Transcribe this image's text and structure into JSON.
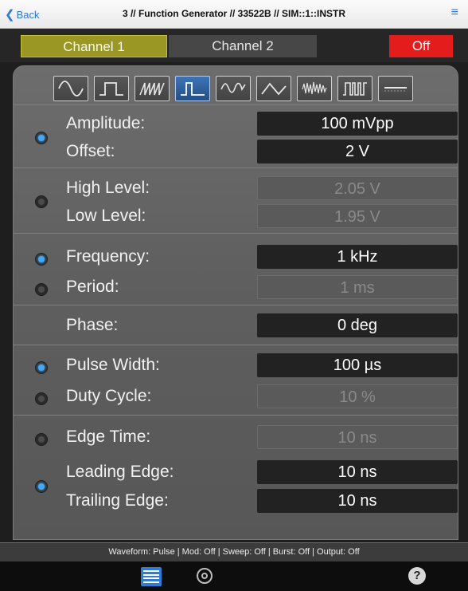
{
  "nav": {
    "back_label": "Back",
    "title": "3 // Function Generator // 33522B // SIM::1::INSTR"
  },
  "channels": {
    "ch1": "Channel 1",
    "ch2": "Channel 2",
    "output": "Off"
  },
  "waveforms": [
    {
      "icon": "sine-wave-icon",
      "active": false
    },
    {
      "icon": "square-wave-icon",
      "active": false
    },
    {
      "icon": "ramp-wave-icon",
      "active": false
    },
    {
      "icon": "pulse-wave-icon",
      "active": true
    },
    {
      "icon": "arbitrary-wave-icon",
      "active": false
    },
    {
      "icon": "triangle-wave-icon",
      "active": false
    },
    {
      "icon": "noise-wave-icon",
      "active": false
    },
    {
      "icon": "prbs-wave-icon",
      "active": false
    },
    {
      "icon": "dc-wave-icon",
      "active": false
    }
  ],
  "params": {
    "amplitude": {
      "label": "Amplitude:",
      "value": "100 mVpp"
    },
    "offset": {
      "label": "Offset:",
      "value": "2 V"
    },
    "high_level": {
      "label": "High Level:",
      "value": "2.05 V"
    },
    "low_level": {
      "label": "Low Level:",
      "value": "1.95 V"
    },
    "frequency": {
      "label": "Frequency:",
      "value": "1 kHz"
    },
    "period": {
      "label": "Period:",
      "value": "1 ms"
    },
    "phase": {
      "label": "Phase:",
      "value": "0 deg"
    },
    "pulse_width": {
      "label": "Pulse Width:",
      "value": "100 µs"
    },
    "duty_cycle": {
      "label": "Duty Cycle:",
      "value": "10 %"
    },
    "edge_time": {
      "label": "Edge Time:",
      "value": "10 ns"
    },
    "leading_edge": {
      "label": "Leading Edge:",
      "value": "10 ns"
    },
    "trailing_edge": {
      "label": "Trailing Edge:",
      "value": "10 ns"
    }
  },
  "status": "Waveform: Pulse | Mod: Off | Sweep: Off | Burst: Off | Output: Off",
  "colors": {
    "accent": "#2f78d9",
    "channel1": "#9b9724",
    "output_off": "#e51c1c",
    "radio_on": "#3fa9ff"
  }
}
